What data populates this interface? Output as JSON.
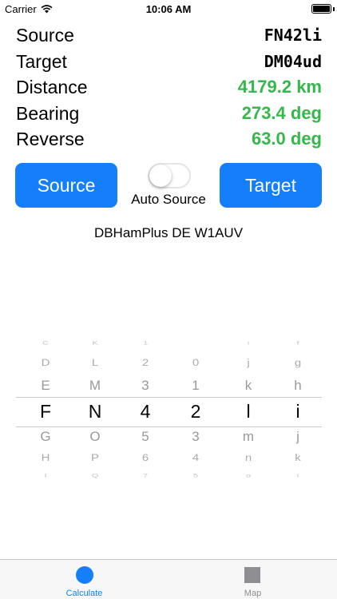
{
  "status_bar": {
    "carrier": "Carrier",
    "time": "10:06 AM"
  },
  "info": {
    "rows": [
      {
        "label": "Source",
        "value": "FN42li",
        "style": "mono"
      },
      {
        "label": "Target",
        "value": "DM04ud",
        "style": "mono"
      },
      {
        "label": "Distance",
        "value": "4179.2 km",
        "style": "green"
      },
      {
        "label": "Bearing",
        "value": "273.4 deg",
        "style": "green"
      },
      {
        "label": "Reverse",
        "value": "63.0 deg",
        "style": "green"
      }
    ]
  },
  "controls": {
    "source_button": "Source",
    "target_button": "Target",
    "toggle_label": "Auto Source",
    "toggle_on": false
  },
  "footer_text": "DBHamPlus DE W1AUV",
  "picker": {
    "columns": [
      [
        "C",
        "D",
        "E",
        "F",
        "G",
        "H",
        "I"
      ],
      [
        "K",
        "L",
        "M",
        "N",
        "O",
        "P",
        "Q"
      ],
      [
        "1",
        "2",
        "3",
        "4",
        "5",
        "6",
        "7"
      ],
      [
        "",
        "0",
        "1",
        "2",
        "3",
        "4",
        "5"
      ],
      [
        "i",
        "j",
        "k",
        "l",
        "m",
        "n",
        "o"
      ],
      [
        "f",
        "g",
        "h",
        "i",
        "j",
        "k",
        "l"
      ]
    ],
    "selected_index": 3
  },
  "tabs": [
    {
      "label": "Calculate",
      "icon": "circle-icon",
      "active": true
    },
    {
      "label": "Map",
      "icon": "square-icon",
      "active": false
    }
  ],
  "colors": {
    "accent": "#157efb",
    "green": "#34b84a",
    "picker_faint": "#8e8e93",
    "inactive_tab": "#8e8e93"
  }
}
